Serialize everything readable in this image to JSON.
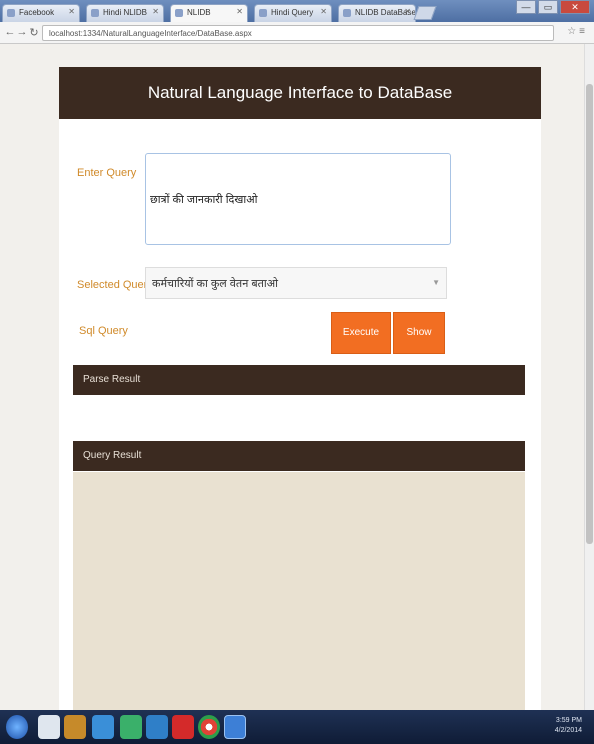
{
  "browser": {
    "tabs": [
      {
        "title": "Facebook"
      },
      {
        "title": "Hindi NLIDB"
      },
      {
        "title": "NLIDB"
      },
      {
        "title": "Hindi Query"
      },
      {
        "title": "NLIDB DataBase"
      }
    ],
    "url": "localhost:1334/NaturalLanguageInterface/DataBase.aspx",
    "window_controls": {
      "minimize": "—",
      "maximize": "▭",
      "close": "✕"
    }
  },
  "app": {
    "title": "Natural Language Interface to DataBase",
    "enter_query_label": "Enter Query",
    "query_text": "छात्रों की जानकारी दिखाओ",
    "selected_queries_label": "Selected Queries",
    "selected_query_value": "कर्मचारियों का कुल वेतन बताओ",
    "sql_query_label": "Sql Query",
    "execute_button": "Execute Query",
    "show_button": "Show Query",
    "parse_result_label": "Parse Result",
    "query_result_label": "Query Result"
  },
  "taskbar": {
    "time": "3:59 PM",
    "date": "4/2/2014"
  },
  "colors": {
    "header_bg": "#3b2a20",
    "accent_orange": "#f26e22",
    "label_orange": "#d08a2a",
    "result_bg": "#e9e1d1"
  }
}
